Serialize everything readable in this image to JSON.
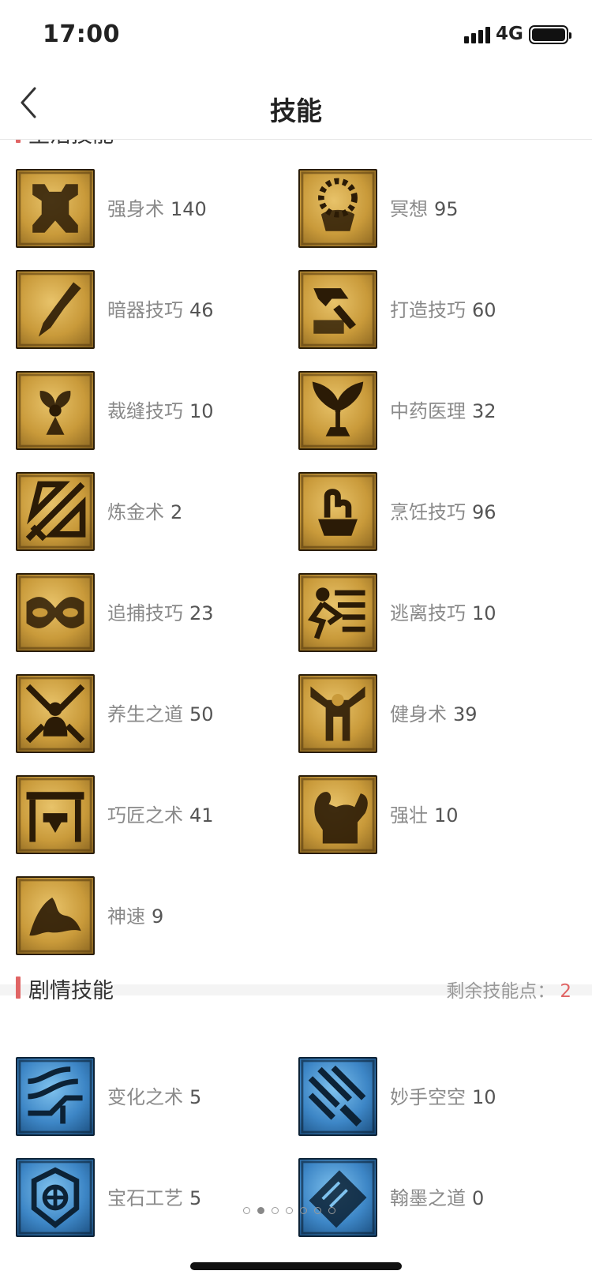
{
  "status": {
    "time": "17:00",
    "network": "4G"
  },
  "nav": {
    "title": "技能"
  },
  "life_section": {
    "title": "生活技能"
  },
  "life_skills": [
    {
      "name": "强身术",
      "level": "140",
      "icon": "fortify-icon"
    },
    {
      "name": "冥想",
      "level": "95",
      "icon": "meditation-icon"
    },
    {
      "name": "暗器技巧",
      "level": "46",
      "icon": "dart-icon"
    },
    {
      "name": "打造技巧",
      "level": "60",
      "icon": "forge-hammer-icon"
    },
    {
      "name": "裁缝技巧",
      "level": "10",
      "icon": "tailoring-icon"
    },
    {
      "name": "中药医理",
      "level": "32",
      "icon": "herb-medicine-icon"
    },
    {
      "name": "炼金术",
      "level": "2",
      "icon": "alchemy-icon"
    },
    {
      "name": "烹饪技巧",
      "level": "96",
      "icon": "cooking-icon"
    },
    {
      "name": "追捕技巧",
      "level": "23",
      "icon": "pursuit-icon"
    },
    {
      "name": "逃离技巧",
      "level": "10",
      "icon": "escape-icon"
    },
    {
      "name": "养生之道",
      "level": "50",
      "icon": "health-cultivation-icon"
    },
    {
      "name": "健身术",
      "level": "39",
      "icon": "fitness-icon"
    },
    {
      "name": "巧匠之术",
      "level": "41",
      "icon": "craftsman-icon"
    },
    {
      "name": "强壮",
      "level": "10",
      "icon": "strength-icon"
    },
    {
      "name": "神速",
      "level": "9",
      "icon": "swiftness-icon"
    }
  ],
  "story_section": {
    "title": "剧情技能",
    "remaining_label": "剩余技能点：",
    "remaining_points": "2"
  },
  "story_skills": [
    {
      "name": "变化之术",
      "level": "5",
      "icon": "transformation-icon"
    },
    {
      "name": "妙手空空",
      "level": "10",
      "icon": "pickpocket-icon"
    },
    {
      "name": "宝石工艺",
      "level": "5",
      "icon": "gem-craft-icon"
    },
    {
      "name": "翰墨之道",
      "level": "0",
      "icon": "calligraphy-icon"
    }
  ],
  "pager": {
    "total": 7,
    "active_index": 1
  },
  "colors": {
    "accent": "#e06464",
    "gold_icon": "#c99a3a",
    "blue_icon": "#3d86c6"
  }
}
